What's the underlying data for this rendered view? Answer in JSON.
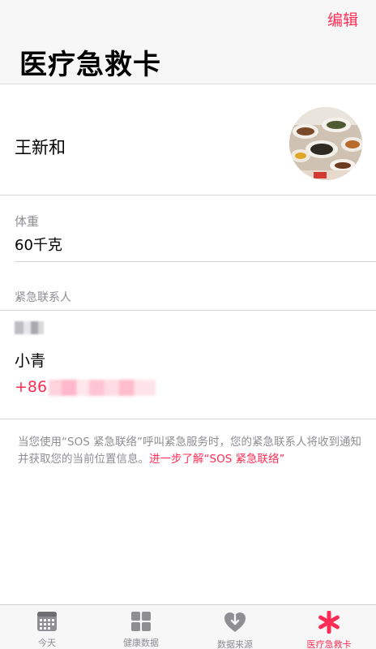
{
  "header": {
    "edit_label": "编辑",
    "title": "医疗急救卡"
  },
  "profile": {
    "name": "王新和",
    "avatar": "avatar-photo"
  },
  "fields": [
    {
      "label": "体重",
      "value": "60千克"
    }
  ],
  "emergency_contacts": {
    "section_title": "紧急联系人",
    "contact": {
      "relation": "",
      "name": "小青",
      "phone_prefix": "+86 1"
    }
  },
  "note": {
    "text": "当您使用“SOS 紧急联络”呼叫紧急服务时，您的紧急联系人将收到通知并获取您的当前位置信息。",
    "link_text": "进一步了解“SOS 紧急联络”"
  },
  "tabbar": {
    "items": [
      {
        "label": "今天",
        "icon": "calendar-icon"
      },
      {
        "label": "健康数据",
        "icon": "grid-icon"
      },
      {
        "label": "数据来源",
        "icon": "download-heart-icon"
      },
      {
        "label": "医疗急救卡",
        "icon": "asterisk-icon",
        "active": true
      }
    ]
  },
  "colors": {
    "accent": "#ff2d55",
    "secondary_text": "#8e8e93",
    "bar_background": "#f7f7f8"
  }
}
